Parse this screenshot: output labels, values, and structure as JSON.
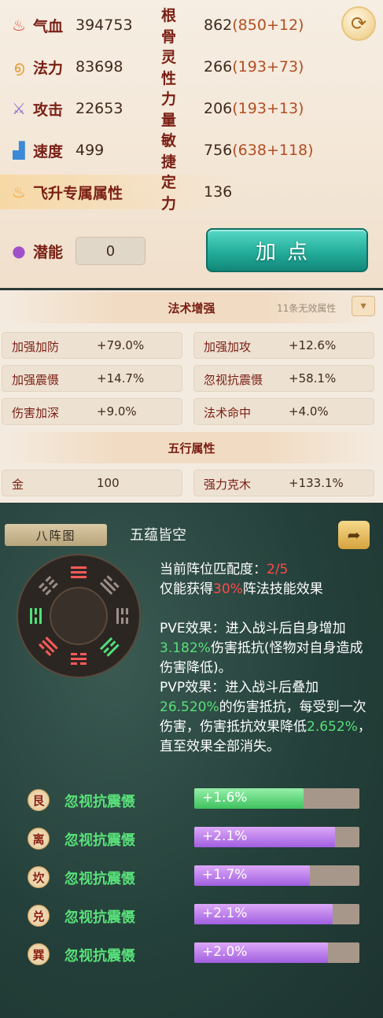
{
  "attributes": {
    "left": [
      {
        "label": "气血",
        "value": "394753",
        "icon": "blood-drop-icon",
        "glyph": "♨",
        "color": "#e2483a"
      },
      {
        "label": "法力",
        "value": "83698",
        "icon": "mana-swirl-icon",
        "glyph": "൭",
        "color": "#e79a2a"
      },
      {
        "label": "攻击",
        "value": "22653",
        "icon": "sword-icon",
        "glyph": "⚔",
        "color": "#8a6fd0"
      },
      {
        "label": "速度",
        "value": "499",
        "icon": "boot-icon",
        "glyph": "▟",
        "color": "#3a8ad8"
      },
      {
        "label": "飞升专属属性",
        "value": "",
        "icon": "flame-icon",
        "glyph": "♨",
        "color": "#f0a030"
      }
    ],
    "right": [
      {
        "label": "根骨",
        "base": "862",
        "extra": "(850+12)"
      },
      {
        "label": "灵性",
        "base": "266",
        "extra": "(193+73)"
      },
      {
        "label": "力量",
        "base": "206",
        "extra": "(193+13)"
      },
      {
        "label": "敏捷",
        "base": "756",
        "extra": "(638+118)"
      },
      {
        "label": "定力",
        "base": "136",
        "extra": ""
      }
    ],
    "potential": {
      "label": "潜能",
      "value": "0"
    },
    "add_point_label": "加点"
  },
  "spell": {
    "title": "法术增强",
    "invalid_note": "11条无效属性",
    "cells": [
      {
        "label": "加强加防",
        "value": "+79.0%"
      },
      {
        "label": "加强加攻",
        "value": "+12.6%"
      },
      {
        "label": "加强震慑",
        "value": "+14.7%"
      },
      {
        "label": "忽视抗震慑",
        "value": "+58.1%"
      },
      {
        "label": "伤害加深",
        "value": "+9.0%"
      },
      {
        "label": "法术命中",
        "value": "+4.0%"
      }
    ],
    "wuxing_title": "五行属性",
    "wuxing_cells": [
      {
        "label": "金",
        "value": "100"
      },
      {
        "label": "强力克木",
        "value": "+133.1%"
      }
    ]
  },
  "formation": {
    "tab_label": "八阵图",
    "name": "五蕴皆空",
    "match_prefix": "当前阵位匹配度：",
    "match_value": "2/5",
    "effect_prefix": "仅能获得",
    "effect_percent": "30%",
    "effect_suffix": "阵法技能效果",
    "pve": {
      "a": "PVE效果：进入战斗后自身增加",
      "b": "3.182%",
      "c": "伤害抵抗(怪物对自身造成伤害降低)。"
    },
    "pvp": {
      "a": "PVP效果：进入战斗后叠加",
      "b": "26.520%",
      "c": "的伤害抵抗，每受到一次伤害，伤害抵抗效果降低",
      "d": "2.652%",
      "e": "，直至效果全部消失。"
    },
    "bonuses": [
      {
        "badge": "艮",
        "name": "忽视抗震慑",
        "value": "+1.6%",
        "fill": 0.66,
        "style": "green"
      },
      {
        "badge": "离",
        "name": "忽视抗震慑",
        "value": "+2.1%",
        "fill": 0.85,
        "style": "purple"
      },
      {
        "badge": "坎",
        "name": "忽视抗震慑",
        "value": "+1.7%",
        "fill": 0.7,
        "style": "purple"
      },
      {
        "badge": "兑",
        "name": "忽视抗震慑",
        "value": "+2.1%",
        "fill": 0.84,
        "style": "purple"
      },
      {
        "badge": "巽",
        "name": "忽视抗震慑",
        "value": "+2.0%",
        "fill": 0.81,
        "style": "purple"
      }
    ]
  }
}
